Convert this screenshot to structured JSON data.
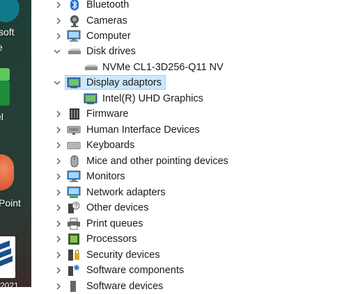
{
  "desktop": {
    "labels": [
      "soft",
      "e",
      "el",
      "Point",
      "2021"
    ]
  },
  "device_manager": {
    "items": [
      {
        "label": "Bluetooth",
        "icon": "bluetooth-icon",
        "state": "collapsed"
      },
      {
        "label": "Cameras",
        "icon": "camera-icon",
        "state": "collapsed"
      },
      {
        "label": "Computer",
        "icon": "computer-icon",
        "state": "collapsed"
      },
      {
        "label": "Disk drives",
        "icon": "disk-drive-icon",
        "state": "expanded"
      },
      {
        "label": "NVMe CL1-3D256-Q11 NV",
        "icon": "disk-drive-icon",
        "state": "child"
      },
      {
        "label": "Display adaptors",
        "icon": "display-adapter-icon",
        "state": "expanded-selected"
      },
      {
        "label": "Intel(R) UHD Graphics",
        "icon": "display-adapter-icon",
        "state": "child"
      },
      {
        "label": "Firmware",
        "icon": "firmware-icon",
        "state": "collapsed"
      },
      {
        "label": "Human Interface Devices",
        "icon": "hid-icon",
        "state": "collapsed"
      },
      {
        "label": "Keyboards",
        "icon": "keyboard-icon",
        "state": "collapsed"
      },
      {
        "label": "Mice and other pointing devices",
        "icon": "mouse-icon",
        "state": "collapsed"
      },
      {
        "label": "Monitors",
        "icon": "monitor-icon",
        "state": "collapsed"
      },
      {
        "label": "Network adapters",
        "icon": "network-adapter-icon",
        "state": "collapsed"
      },
      {
        "label": "Other devices",
        "icon": "other-devices-icon",
        "state": "collapsed"
      },
      {
        "label": "Print queues",
        "icon": "printer-icon",
        "state": "collapsed"
      },
      {
        "label": "Processors",
        "icon": "processor-icon",
        "state": "collapsed"
      },
      {
        "label": "Security devices",
        "icon": "security-device-icon",
        "state": "collapsed"
      },
      {
        "label": "Software components",
        "icon": "software-component-icon",
        "state": "collapsed"
      },
      {
        "label": "Software devices",
        "icon": "software-device-icon",
        "state": "collapsed"
      }
    ],
    "colors": {
      "selection_bg": "#cce8ff",
      "selection_border": "#99d1ff"
    }
  }
}
